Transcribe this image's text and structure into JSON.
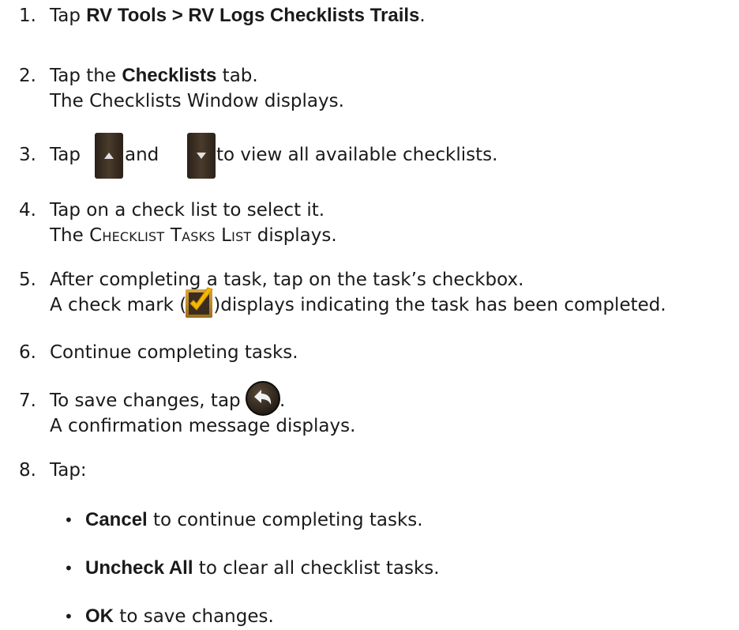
{
  "steps": [
    {
      "number": "1.",
      "pre": "Tap ",
      "bold": "RV Tools > RV Logs Checklists Trails",
      "post": "."
    },
    {
      "number": "2.",
      "pre": "Tap the ",
      "bold": "Checklists",
      "post": " tab.",
      "line2": "The Checklists Window displays."
    },
    {
      "number": "3.",
      "pre": "Tap ",
      "mid": " and ",
      "post": " to view all available checklists.",
      "icons": [
        "scroll-up-arrow-icon",
        "scroll-down-arrow-icon"
      ]
    },
    {
      "number": "4.",
      "text": "Tap on a check list to select it.",
      "line2_pre": "The ",
      "line2_sc": "Checklist Tasks List",
      "line2_post": " displays."
    },
    {
      "number": "5.",
      "text": "After completing a task, tap on the task’s checkbox.",
      "line2_pre": "A check mark (",
      "line2_post": ")displays indicating the task has been completed.",
      "icon": "checkmark-checkbox-icon"
    },
    {
      "number": "6.",
      "text": "Continue completing tasks."
    },
    {
      "number": "7.",
      "pre": "To save changes, tap ",
      "post": ".",
      "line2": "A confirmation message displays.",
      "icon": "back-arrow-icon"
    },
    {
      "number": "8.",
      "text": "Tap:"
    }
  ],
  "bullets": [
    {
      "symbol": "•",
      "bold": "Cancel",
      "text": " to continue completing tasks."
    },
    {
      "symbol": "•",
      "bold": "Uncheck All",
      "text": " to clear all checklist tasks."
    },
    {
      "symbol": "•",
      "bold": "OK",
      "text": " to save changes."
    }
  ]
}
